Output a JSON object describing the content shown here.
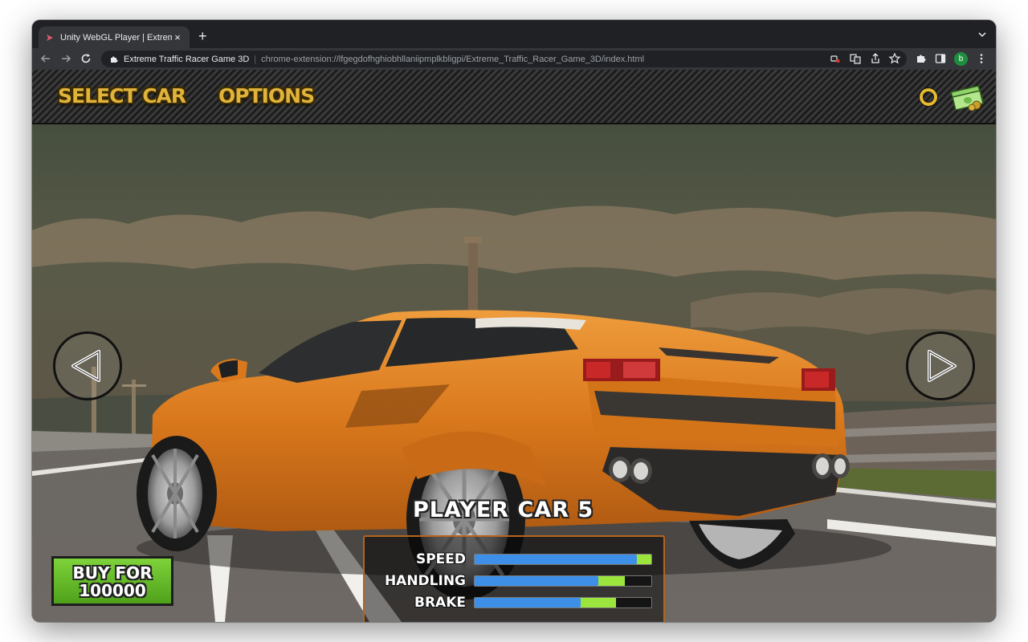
{
  "browser": {
    "tab_title": "Unity WebGL Player | Extreme",
    "site_name": "Extreme Traffic Racer Game 3D",
    "url": "chrome-extension://lfgegdofhghiobhllaniipmplkbligpi/Extreme_Traffic_Racer_Game_3D/index.html",
    "profile_initial": "b",
    "new_tab_label": "+",
    "close_tab_label": "×"
  },
  "game": {
    "menu": {
      "select_car_label": "SELECT CAR",
      "options_label": "OPTIONS"
    },
    "car_name": "PLAYER CAR 5",
    "stats": [
      {
        "label": "SPEED",
        "blue": 0.92,
        "green": 1.0
      },
      {
        "label": "HANDLING",
        "blue": 0.7,
        "green": 0.85
      },
      {
        "label": "BRAKE",
        "blue": 0.6,
        "green": 0.8
      }
    ],
    "buy_button": {
      "line1": "BUY FOR",
      "line2": "100000"
    }
  },
  "colors": {
    "menu_text": "#e0b33a",
    "stat_blue": "#3d8fe8",
    "stat_green": "#9be53c",
    "buy_green": "#5cb82a",
    "car_orange": "#d9781c"
  },
  "icons": {
    "favicon": "unity-icon",
    "coin": "coin-icon",
    "cash": "cash-stack-icon",
    "prev": "arrow-left-icon",
    "next": "arrow-right-icon"
  }
}
